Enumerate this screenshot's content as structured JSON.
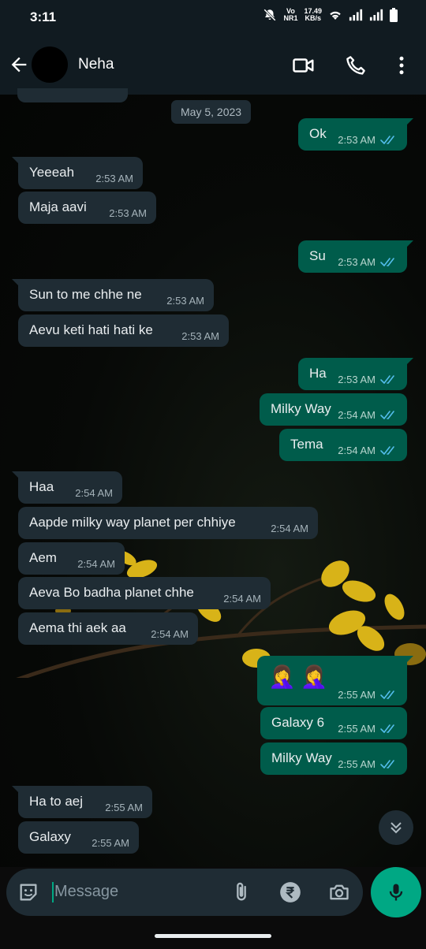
{
  "status_bar": {
    "time": "3:11",
    "network_label": "Vo NR1",
    "speed_value": "17.49",
    "speed_unit": "KB/s"
  },
  "header": {
    "contact_name": "Neha"
  },
  "chat": {
    "date_chip": "May 5, 2023",
    "messages": [
      {
        "dir": "out",
        "text": "Ok",
        "time": "2:53 AM"
      },
      {
        "dir": "in",
        "text": "Yeeeah",
        "time": "2:53 AM"
      },
      {
        "dir": "in",
        "text": "Maja aavi",
        "time": "2:53 AM"
      },
      {
        "dir": "out",
        "text": "Su",
        "time": "2:53 AM"
      },
      {
        "dir": "in",
        "text": "Sun to me chhe ne",
        "time": "2:53 AM"
      },
      {
        "dir": "in",
        "text": "Aevu keti hati hati ke",
        "time": "2:53 AM"
      },
      {
        "dir": "out",
        "text": "Ha",
        "time": "2:53 AM"
      },
      {
        "dir": "out",
        "text": "Milky Way",
        "time": "2:54 AM"
      },
      {
        "dir": "out",
        "text": "Tema",
        "time": "2:54 AM"
      },
      {
        "dir": "in",
        "text": "Haa",
        "time": "2:54 AM"
      },
      {
        "dir": "in",
        "text": "Aapde milky way planet per chhiye",
        "time": "2:54 AM"
      },
      {
        "dir": "in",
        "text": "Aem",
        "time": "2:54 AM"
      },
      {
        "dir": "in",
        "text": "Aeva Bo badha planet chhe",
        "time": "2:54 AM"
      },
      {
        "dir": "in",
        "text": "Aema thi aek aa",
        "time": "2:54 AM"
      },
      {
        "dir": "out",
        "text": "🤦‍♀️🤦‍♀️",
        "time": "2:55 AM"
      },
      {
        "dir": "out",
        "text": "Galaxy 6",
        "time": "2:55 AM"
      },
      {
        "dir": "out",
        "text": "Milky Way",
        "time": "2:55 AM"
      },
      {
        "dir": "in",
        "text": "Ha to aej",
        "time": "2:55 AM"
      },
      {
        "dir": "in",
        "text": "Galaxy",
        "time": "2:55 AM"
      }
    ]
  },
  "input": {
    "placeholder": "Message"
  },
  "icons": {
    "back": "arrow-left-icon",
    "video": "video-camera-icon",
    "call": "phone-icon",
    "menu": "more-vert-icon",
    "sticker": "sticker-icon",
    "attach": "paperclip-icon",
    "payment": "rupee-icon",
    "camera": "camera-icon",
    "mic": "mic-icon",
    "scroll": "double-chevron-down-icon",
    "read": "double-check-icon"
  },
  "colors": {
    "incoming": "#1f2c34",
    "outgoing": "#005c4b",
    "accent": "#00a884",
    "read_ticks": "#53bdeb"
  }
}
